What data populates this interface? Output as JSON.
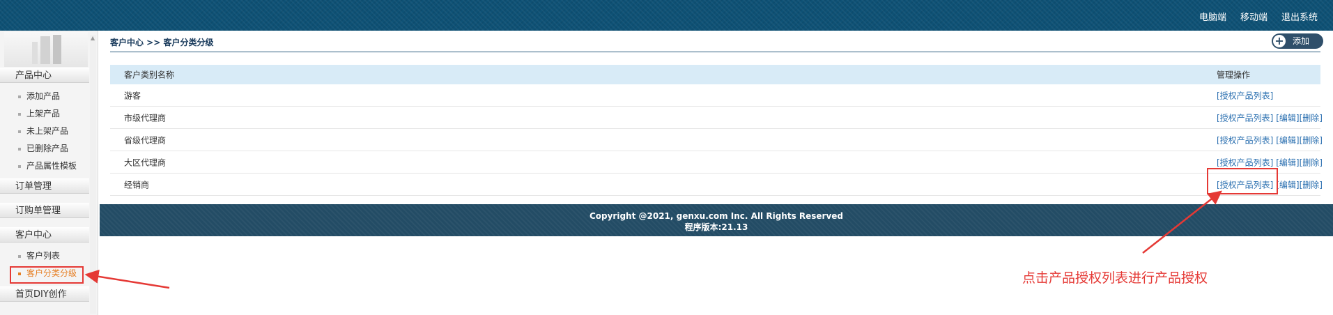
{
  "header": {
    "links": [
      "电脑端",
      "移动端",
      "退出系统"
    ]
  },
  "sidebar": {
    "sections": [
      {
        "label": "产品中心",
        "items": [
          "添加产品",
          "上架产品",
          "未上架产品",
          "已删除产品",
          "产品属性模板"
        ]
      },
      {
        "label": "订单管理",
        "items": []
      },
      {
        "label": "订购单管理",
        "items": []
      },
      {
        "label": "客户中心",
        "items": [
          "客户列表",
          "客户分类分级"
        ]
      },
      {
        "label": "首页DIY创作",
        "items": []
      }
    ],
    "active_item": "客户分类分级"
  },
  "breadcrumb": "客户中心 >> 客户分类分级",
  "add_button": {
    "label": "添加",
    "icon": "plus-circle-icon"
  },
  "table": {
    "headers": [
      "客户类别名称",
      "管理操作"
    ],
    "rows": [
      {
        "name": "游客",
        "ops": [
          "[授权产品列表]"
        ]
      },
      {
        "name": "市级代理商",
        "ops": [
          "[授权产品列表]",
          "[编辑]",
          "[删除]"
        ]
      },
      {
        "name": "省级代理商",
        "ops": [
          "[授权产品列表]",
          "[编辑]",
          "[删除]"
        ]
      },
      {
        "name": "大区代理商",
        "ops": [
          "[授权产品列表]",
          "[编辑]",
          "[删除]"
        ]
      },
      {
        "name": "经销商",
        "ops": [
          "[授权产品列表]",
          "[编辑]",
          "[删除]"
        ]
      }
    ]
  },
  "footer": {
    "copyright": "Copyright @2021, genxu.com Inc. All Rights Reserved",
    "version": "程序版本:21.13"
  },
  "annotation": {
    "text": "点击产品授权列表进行产品授权",
    "color": "#e53935"
  },
  "colors": {
    "topbar": "#0e5175",
    "footer": "#234c65",
    "table_header": "#d8ebf7",
    "link": "#2a6fb0",
    "active": "#e67e22"
  }
}
